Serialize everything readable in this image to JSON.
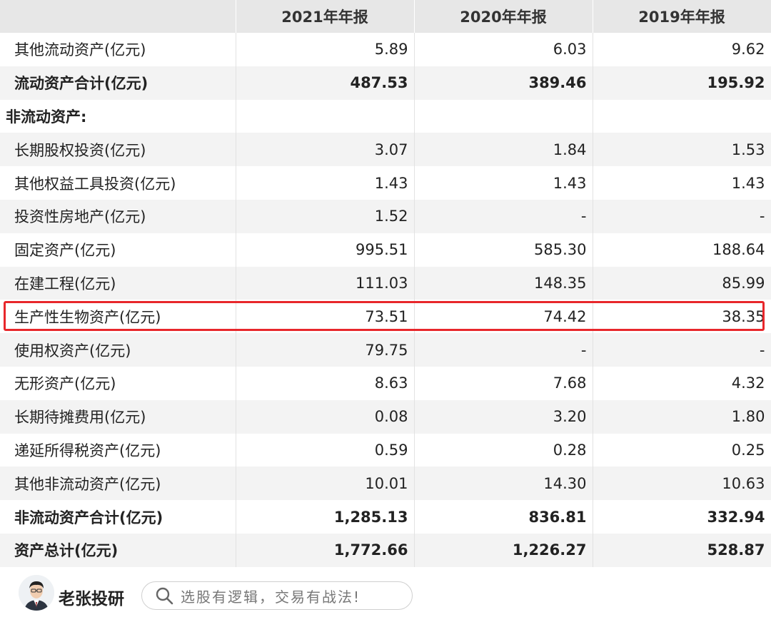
{
  "table": {
    "corner": "",
    "headers": [
      "2021年年报",
      "2020年年报",
      "2019年年报"
    ],
    "rows": [
      {
        "label": "其他流动资产(亿元)",
        "values": [
          "5.89",
          "6.03",
          "9.62"
        ],
        "style": "normal"
      },
      {
        "label": "流动资产合计(亿元)",
        "values": [
          "487.53",
          "389.46",
          "195.92"
        ],
        "style": "bold"
      },
      {
        "label": "非流动资产:",
        "values": [
          "",
          "",
          ""
        ],
        "style": "section"
      },
      {
        "label": "长期股权投资(亿元)",
        "values": [
          "3.07",
          "1.84",
          "1.53"
        ],
        "style": "normal"
      },
      {
        "label": "其他权益工具投资(亿元)",
        "values": [
          "1.43",
          "1.43",
          "1.43"
        ],
        "style": "normal"
      },
      {
        "label": "投资性房地产(亿元)",
        "values": [
          "1.52",
          "-",
          "-"
        ],
        "style": "normal"
      },
      {
        "label": "固定资产(亿元)",
        "values": [
          "995.51",
          "585.30",
          "188.64"
        ],
        "style": "normal"
      },
      {
        "label": "在建工程(亿元)",
        "values": [
          "111.03",
          "148.35",
          "85.99"
        ],
        "style": "normal"
      },
      {
        "label": "生产性生物资产(亿元)",
        "values": [
          "73.51",
          "74.42",
          "38.35"
        ],
        "style": "normal",
        "highlighted": true
      },
      {
        "label": "使用权资产(亿元)",
        "values": [
          "79.75",
          "-",
          "-"
        ],
        "style": "normal"
      },
      {
        "label": "无形资产(亿元)",
        "values": [
          "8.63",
          "7.68",
          "4.32"
        ],
        "style": "normal"
      },
      {
        "label": "长期待摊费用(亿元)",
        "values": [
          "0.08",
          "3.20",
          "1.80"
        ],
        "style": "normal"
      },
      {
        "label": "递延所得税资产(亿元)",
        "values": [
          "0.59",
          "0.28",
          "0.25"
        ],
        "style": "normal"
      },
      {
        "label": "其他非流动资产(亿元)",
        "values": [
          "10.01",
          "14.30",
          "10.63"
        ],
        "style": "normal"
      },
      {
        "label": "非流动资产合计(亿元)",
        "values": [
          "1,285.13",
          "836.81",
          "332.94"
        ],
        "style": "bold"
      },
      {
        "label": "资产总计(亿元)",
        "values": [
          "1,772.66",
          "1,226.27",
          "528.87"
        ],
        "style": "bold"
      }
    ]
  },
  "footer": {
    "brand": "老张投研",
    "slogan": "选股有逻辑，交易有战法!",
    "avatar_icon": "person-avatar-icon",
    "search_icon": "search-icon"
  },
  "colors": {
    "highlight_border": "#e8272b",
    "header_bg": "#e7e7e7",
    "stripe_bg": "#f3f3f3"
  }
}
